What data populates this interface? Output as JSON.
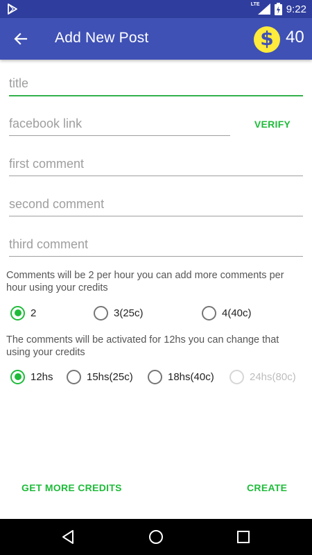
{
  "status_bar": {
    "time": "9:22",
    "network_label": "LTE",
    "icons": [
      "play-store-icon",
      "signal-icon",
      "battery-icon"
    ]
  },
  "app_bar": {
    "title": "Add New Post",
    "back_icon": "arrow-back-icon",
    "coin_symbol": "$",
    "credits": "40",
    "colors": {
      "primary": "#3f51b5",
      "status": "#2f3e9e",
      "coin": "#ffeb3b"
    }
  },
  "form": {
    "title_placeholder": "title",
    "facebook_placeholder": "facebook link",
    "verify_label": "VERIFY",
    "first_comment_placeholder": "first comment",
    "second_comment_placeholder": "second comment",
    "third_comment_placeholder": "third comment",
    "accent_color": "#1fbb3a"
  },
  "comments_per_hour": {
    "info": "Comments will be 2 per hour you can add more comments per hour using your credits",
    "options": [
      "2",
      "3(25c)",
      "4(40c)"
    ],
    "selected": "2"
  },
  "activation": {
    "info": "The comments will be activated for 12hs you can change that using your credits",
    "options": [
      "12hs",
      "15hs(25c)",
      "18hs(40c)",
      "24hs(80c)"
    ],
    "selected": "12hs",
    "disabled": [
      "24hs(80c)"
    ]
  },
  "footer": {
    "get_credits_label": "GET MORE CREDITS",
    "create_label": "CREATE"
  },
  "nav_bar": {
    "icons": [
      "back-triangle-icon",
      "home-circle-icon",
      "recents-square-icon"
    ]
  }
}
